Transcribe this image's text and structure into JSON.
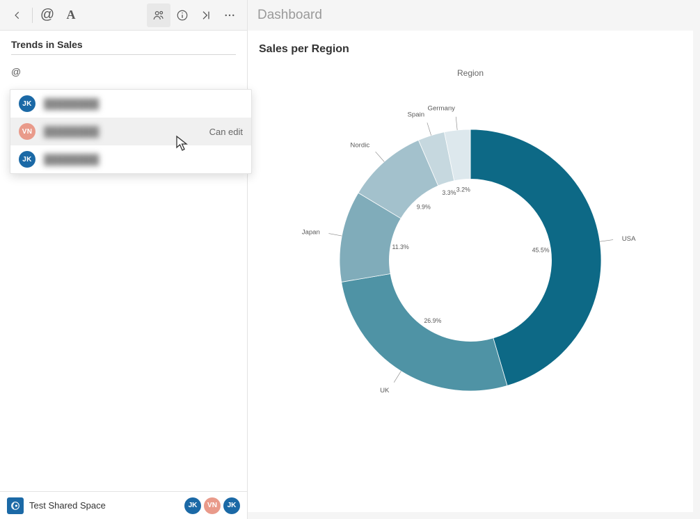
{
  "header": {
    "title": "Dashboard"
  },
  "toolbar": {
    "icons": [
      "back",
      "at",
      "text-format",
      "share",
      "info",
      "collapse",
      "more"
    ]
  },
  "panel": {
    "title": "Trends in Sales",
    "mention_value": "@",
    "mention_placeholder": ""
  },
  "suggestions": {
    "items": [
      {
        "initials": "JK",
        "name": "████████",
        "color": "blue",
        "permission": ""
      },
      {
        "initials": "VN",
        "name": "████████",
        "color": "coral",
        "permission": "Can edit",
        "hover": true
      },
      {
        "initials": "JK",
        "name": "████████",
        "color": "blue",
        "permission": ""
      }
    ]
  },
  "footer": {
    "space_name": "Test Shared Space",
    "avatars": [
      {
        "initials": "JK",
        "color": "blue"
      },
      {
        "initials": "VN",
        "color": "coral"
      },
      {
        "initials": "JK",
        "color": "blue"
      }
    ]
  },
  "chart": {
    "title": "Sales per Region",
    "legend_title": "Region"
  },
  "chart_data": {
    "type": "pie",
    "title": "Sales per Region",
    "legend_title": "Region",
    "series": [
      {
        "name": "USA",
        "value": 45.5,
        "color": "#0d6986"
      },
      {
        "name": "UK",
        "value": 26.9,
        "color": "#4f93a5"
      },
      {
        "name": "Japan",
        "value": 11.3,
        "color": "#80acba"
      },
      {
        "name": "Nordic",
        "value": 9.9,
        "color": "#a3c1cc"
      },
      {
        "name": "Spain",
        "value": 3.3,
        "color": "#c6d8df"
      },
      {
        "name": "Germany",
        "value": 3.2,
        "color": "#dde8ed"
      }
    ],
    "donut_inner_ratio": 0.62,
    "start_angle_deg": -90
  }
}
